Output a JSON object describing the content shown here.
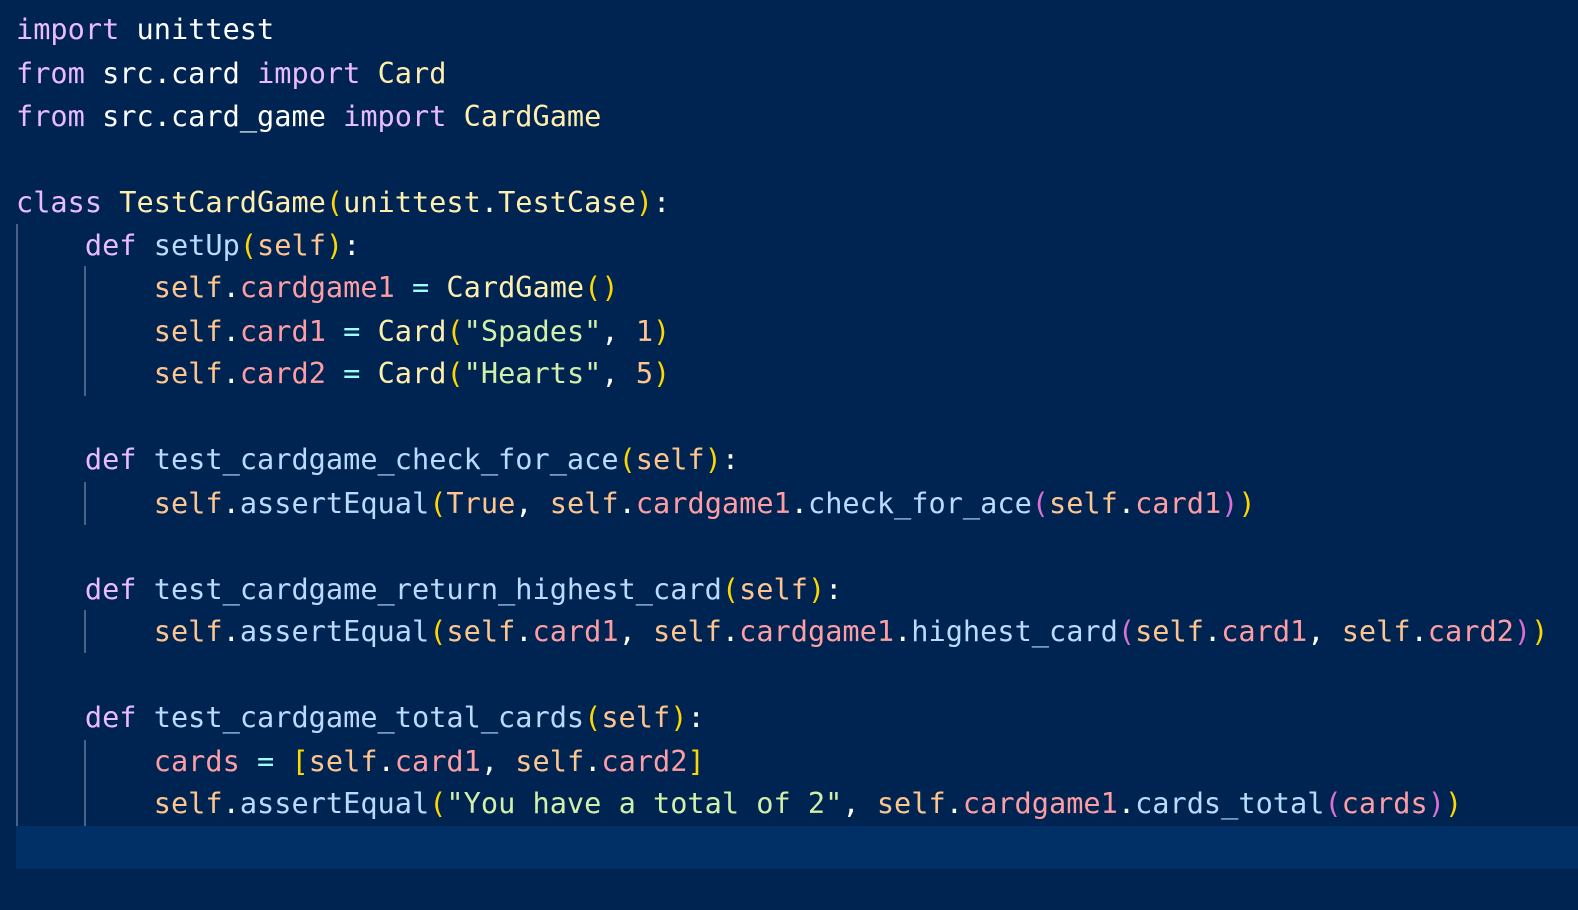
{
  "editor": {
    "theme_colors": {
      "background": "#002451",
      "current_line": "#003066",
      "keyword": "#ebbbff",
      "class_name": "#ffeead",
      "function": "#bbdaff",
      "self": "#ffc58f",
      "attribute": "#ff9da4",
      "string": "#d1f1a9",
      "operator": "#99ffff",
      "bracket_level1": "#ffd700",
      "bracket_level2": "#da70d6",
      "indent_guide": "#4a6285"
    },
    "lines": [
      [
        {
          "t": "import",
          "k": "kw"
        },
        {
          "t": " ",
          "k": "id"
        },
        {
          "t": "unittest",
          "k": "id"
        }
      ],
      [
        {
          "t": "from",
          "k": "kw"
        },
        {
          "t": " src",
          "k": "id"
        },
        {
          "t": ".",
          "k": "pun"
        },
        {
          "t": "card",
          "k": "id"
        },
        {
          "t": " ",
          "k": "id"
        },
        {
          "t": "import",
          "k": "kw"
        },
        {
          "t": " ",
          "k": "id"
        },
        {
          "t": "Card",
          "k": "cls"
        }
      ],
      [
        {
          "t": "from",
          "k": "kw"
        },
        {
          "t": " src",
          "k": "id"
        },
        {
          "t": ".",
          "k": "pun"
        },
        {
          "t": "card_game",
          "k": "id"
        },
        {
          "t": " ",
          "k": "id"
        },
        {
          "t": "import",
          "k": "kw"
        },
        {
          "t": " ",
          "k": "id"
        },
        {
          "t": "CardGame",
          "k": "cls"
        }
      ],
      [],
      [
        {
          "t": "class",
          "k": "kw"
        },
        {
          "t": " ",
          "k": "id"
        },
        {
          "t": "TestCardGame",
          "k": "cls"
        },
        {
          "t": "(",
          "k": "b1"
        },
        {
          "t": "unittest",
          "k": "cls"
        },
        {
          "t": ".",
          "k": "pun"
        },
        {
          "t": "TestCase",
          "k": "cls"
        },
        {
          "t": ")",
          "k": "b1"
        },
        {
          "t": ":",
          "k": "pun"
        }
      ],
      [
        {
          "t": "    ",
          "k": "id"
        },
        {
          "t": "def",
          "k": "kw"
        },
        {
          "t": " ",
          "k": "id"
        },
        {
          "t": "setUp",
          "k": "fn"
        },
        {
          "t": "(",
          "k": "b1"
        },
        {
          "t": "self",
          "k": "self"
        },
        {
          "t": ")",
          "k": "b1"
        },
        {
          "t": ":",
          "k": "pun"
        }
      ],
      [
        {
          "t": "        ",
          "k": "id"
        },
        {
          "t": "self",
          "k": "self"
        },
        {
          "t": ".",
          "k": "pun"
        },
        {
          "t": "cardgame1",
          "k": "attr"
        },
        {
          "t": " ",
          "k": "id"
        },
        {
          "t": "=",
          "k": "op"
        },
        {
          "t": " ",
          "k": "id"
        },
        {
          "t": "CardGame",
          "k": "cls"
        },
        {
          "t": "()",
          "k": "b1"
        }
      ],
      [
        {
          "t": "        ",
          "k": "id"
        },
        {
          "t": "self",
          "k": "self"
        },
        {
          "t": ".",
          "k": "pun"
        },
        {
          "t": "card1",
          "k": "attr"
        },
        {
          "t": " ",
          "k": "id"
        },
        {
          "t": "=",
          "k": "op"
        },
        {
          "t": " ",
          "k": "id"
        },
        {
          "t": "Card",
          "k": "cls"
        },
        {
          "t": "(",
          "k": "b1"
        },
        {
          "t": "\"Spades\"",
          "k": "str"
        },
        {
          "t": ", ",
          "k": "pun"
        },
        {
          "t": "1",
          "k": "num"
        },
        {
          "t": ")",
          "k": "b1"
        }
      ],
      [
        {
          "t": "        ",
          "k": "id"
        },
        {
          "t": "self",
          "k": "self"
        },
        {
          "t": ".",
          "k": "pun"
        },
        {
          "t": "card2",
          "k": "attr"
        },
        {
          "t": " ",
          "k": "id"
        },
        {
          "t": "=",
          "k": "op"
        },
        {
          "t": " ",
          "k": "id"
        },
        {
          "t": "Card",
          "k": "cls"
        },
        {
          "t": "(",
          "k": "b1"
        },
        {
          "t": "\"Hearts\"",
          "k": "str"
        },
        {
          "t": ", ",
          "k": "pun"
        },
        {
          "t": "5",
          "k": "num"
        },
        {
          "t": ")",
          "k": "b1"
        }
      ],
      [],
      [
        {
          "t": "    ",
          "k": "id"
        },
        {
          "t": "def",
          "k": "kw"
        },
        {
          "t": " ",
          "k": "id"
        },
        {
          "t": "test_cardgame_check_for_ace",
          "k": "fn"
        },
        {
          "t": "(",
          "k": "b1"
        },
        {
          "t": "self",
          "k": "self"
        },
        {
          "t": ")",
          "k": "b1"
        },
        {
          "t": ":",
          "k": "pun"
        }
      ],
      [
        {
          "t": "        ",
          "k": "id"
        },
        {
          "t": "self",
          "k": "self"
        },
        {
          "t": ".",
          "k": "pun"
        },
        {
          "t": "assertEqual",
          "k": "fn"
        },
        {
          "t": "(",
          "k": "b1"
        },
        {
          "t": "True",
          "k": "num"
        },
        {
          "t": ", ",
          "k": "pun"
        },
        {
          "t": "self",
          "k": "self"
        },
        {
          "t": ".",
          "k": "pun"
        },
        {
          "t": "cardgame1",
          "k": "attr"
        },
        {
          "t": ".",
          "k": "pun"
        },
        {
          "t": "check_for_ace",
          "k": "fn"
        },
        {
          "t": "(",
          "k": "b2"
        },
        {
          "t": "self",
          "k": "self"
        },
        {
          "t": ".",
          "k": "pun"
        },
        {
          "t": "card1",
          "k": "attr"
        },
        {
          "t": ")",
          "k": "b2"
        },
        {
          "t": ")",
          "k": "b1"
        }
      ],
      [],
      [
        {
          "t": "    ",
          "k": "id"
        },
        {
          "t": "def",
          "k": "kw"
        },
        {
          "t": " ",
          "k": "id"
        },
        {
          "t": "test_cardgame_return_highest_card",
          "k": "fn"
        },
        {
          "t": "(",
          "k": "b1"
        },
        {
          "t": "self",
          "k": "self"
        },
        {
          "t": ")",
          "k": "b1"
        },
        {
          "t": ":",
          "k": "pun"
        }
      ],
      [
        {
          "t": "        ",
          "k": "id"
        },
        {
          "t": "self",
          "k": "self"
        },
        {
          "t": ".",
          "k": "pun"
        },
        {
          "t": "assertEqual",
          "k": "fn"
        },
        {
          "t": "(",
          "k": "b1"
        },
        {
          "t": "self",
          "k": "self"
        },
        {
          "t": ".",
          "k": "pun"
        },
        {
          "t": "card1",
          "k": "attr"
        },
        {
          "t": ", ",
          "k": "pun"
        },
        {
          "t": "self",
          "k": "self"
        },
        {
          "t": ".",
          "k": "pun"
        },
        {
          "t": "cardgame1",
          "k": "attr"
        },
        {
          "t": ".",
          "k": "pun"
        },
        {
          "t": "highest_card",
          "k": "fn"
        },
        {
          "t": "(",
          "k": "b2"
        },
        {
          "t": "self",
          "k": "self"
        },
        {
          "t": ".",
          "k": "pun"
        },
        {
          "t": "card1",
          "k": "attr"
        },
        {
          "t": ", ",
          "k": "pun"
        },
        {
          "t": "self",
          "k": "self"
        },
        {
          "t": ".",
          "k": "pun"
        },
        {
          "t": "card2",
          "k": "attr"
        },
        {
          "t": ")",
          "k": "b2"
        },
        {
          "t": ")",
          "k": "b1"
        }
      ],
      [],
      [
        {
          "t": "    ",
          "k": "id"
        },
        {
          "t": "def",
          "k": "kw"
        },
        {
          "t": " ",
          "k": "id"
        },
        {
          "t": "test_cardgame_total_cards",
          "k": "fn"
        },
        {
          "t": "(",
          "k": "b1"
        },
        {
          "t": "self",
          "k": "self"
        },
        {
          "t": ")",
          "k": "b1"
        },
        {
          "t": ":",
          "k": "pun"
        }
      ],
      [
        {
          "t": "        ",
          "k": "id"
        },
        {
          "t": "cards",
          "k": "attr"
        },
        {
          "t": " ",
          "k": "id"
        },
        {
          "t": "=",
          "k": "op"
        },
        {
          "t": " ",
          "k": "id"
        },
        {
          "t": "[",
          "k": "b1"
        },
        {
          "t": "self",
          "k": "self"
        },
        {
          "t": ".",
          "k": "pun"
        },
        {
          "t": "card1",
          "k": "attr"
        },
        {
          "t": ", ",
          "k": "pun"
        },
        {
          "t": "self",
          "k": "self"
        },
        {
          "t": ".",
          "k": "pun"
        },
        {
          "t": "card2",
          "k": "attr"
        },
        {
          "t": "]",
          "k": "b1"
        }
      ],
      [
        {
          "t": "        ",
          "k": "id"
        },
        {
          "t": "self",
          "k": "self"
        },
        {
          "t": ".",
          "k": "pun"
        },
        {
          "t": "assertEqual",
          "k": "fn"
        },
        {
          "t": "(",
          "k": "b1"
        },
        {
          "t": "\"You have a total of 2\"",
          "k": "str"
        },
        {
          "t": ", ",
          "k": "pun"
        },
        {
          "t": "self",
          "k": "self"
        },
        {
          "t": ".",
          "k": "pun"
        },
        {
          "t": "cardgame1",
          "k": "attr"
        },
        {
          "t": ".",
          "k": "pun"
        },
        {
          "t": "cards_total",
          "k": "fn"
        },
        {
          "t": "(",
          "k": "b2"
        },
        {
          "t": "cards",
          "k": "attr"
        },
        {
          "t": ")",
          "k": "b2"
        },
        {
          "t": ")",
          "k": "b1"
        }
      ],
      []
    ]
  }
}
